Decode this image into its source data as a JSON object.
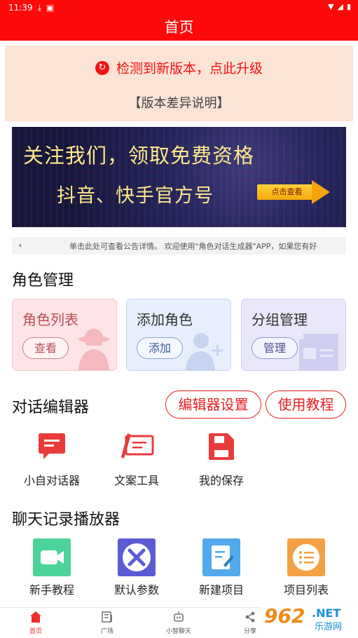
{
  "status_bar": {
    "time": "11:39",
    "icons": [
      "download-icon",
      "notification-icon"
    ],
    "right_icons": [
      "wifi-icon",
      "signal-icon",
      "battery-icon"
    ]
  },
  "header": {
    "title": "首页",
    "color": "#ff0a0a"
  },
  "update_banner": {
    "text": "检测到新版本，点此升级",
    "link": "【版本差异说明】"
  },
  "promo_banner": {
    "line1": "关注我们，领取免费资格",
    "line2": "抖音、快手官方号",
    "button": "点击查看"
  },
  "notice": {
    "text": "单击此处可查看公告详情。 欢迎使用\"角色对话生成器\"APP，如果您有好"
  },
  "role_section": {
    "title": "角色管理",
    "cards": [
      {
        "title": "角色列表",
        "button": "查看"
      },
      {
        "title": "添加角色",
        "button": "添加"
      },
      {
        "title": "分组管理",
        "button": "管理"
      }
    ]
  },
  "editor_section": {
    "title": "对话编辑器",
    "settings_button": "编辑器设置",
    "tutorial_button": "使用教程",
    "tools": [
      {
        "label": "小自对话器",
        "icon": "chat-icon"
      },
      {
        "label": "文案工具",
        "icon": "pen-document-icon"
      },
      {
        "label": "我的保存",
        "icon": "save-icon"
      }
    ]
  },
  "player_section": {
    "title": "聊天记录播放器",
    "items": [
      {
        "label": "新手教程",
        "icon": "video-camera-icon"
      },
      {
        "label": "默认参数",
        "icon": "tools-icon"
      },
      {
        "label": "新建项目",
        "icon": "edit-document-icon"
      },
      {
        "label": "项目列表",
        "icon": "list-icon"
      }
    ]
  },
  "bottom_nav": [
    {
      "label": "首页",
      "icon": "home-icon",
      "active": true
    },
    {
      "label": "广场",
      "icon": "news-icon",
      "active": false
    },
    {
      "label": "小智聊天",
      "icon": "robot-icon",
      "active": false
    },
    {
      "label": "分享",
      "icon": "share-icon",
      "active": false
    }
  ],
  "watermark": {
    "brand": "962",
    "domain": ".NET",
    "caption": "乐游网"
  },
  "colors": {
    "accent": "#ff0a0a",
    "update_bg": "#fbe3d6",
    "promo_text": "#ffe98a"
  }
}
